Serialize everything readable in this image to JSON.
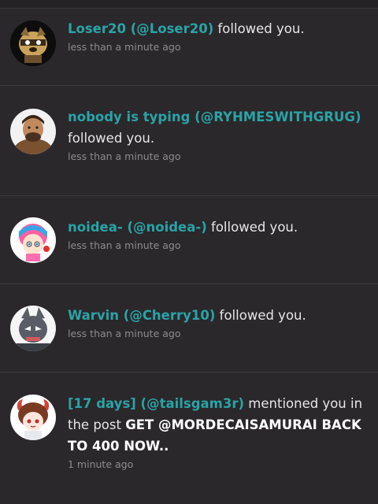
{
  "notifications": [
    {
      "user_link": "Loser20 (@Loser20)",
      "action": " followed you.",
      "time": "less than a minute ago",
      "avatar_icon": "raccoon-avatar-icon"
    },
    {
      "user_link": "nobody is typing (@RYHMESWITHGRUG)",
      "action": "followed you.",
      "time": "less than a minute ago",
      "avatar_icon": "caveman-avatar-icon"
    },
    {
      "user_link": "noidea- (@noidea-)",
      "action": " followed you.",
      "time": "less than a minute ago",
      "avatar_icon": "pink-hair-girl-avatar-icon"
    },
    {
      "user_link": "Warvin (@Cherry10)",
      "action": " followed you.",
      "time": "less than a minute ago",
      "avatar_icon": "gray-creature-avatar-icon"
    },
    {
      "user_link": "[17 days] (@tailsgam3r)",
      "action": " mentioned you in the post ",
      "post_title": "GET @MORDECAISAMURAI BACK TO 400 NOW..",
      "time": "1 minute ago",
      "avatar_icon": "horned-girl-avatar-icon"
    }
  ],
  "colors": {
    "background": "#2a282b",
    "username": "#2aa3a6",
    "timestamp": "#8d8b8e",
    "divider": "#3c3a3d"
  }
}
